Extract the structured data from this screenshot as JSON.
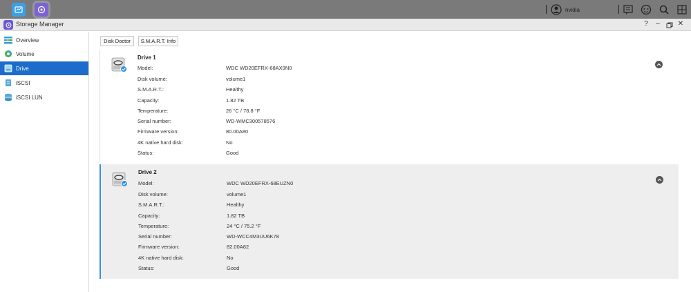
{
  "window": {
    "title": "Storage Manager"
  },
  "taskbar": {
    "username": "nvidia"
  },
  "toolbar": {
    "disk_doctor": "Disk Doctor",
    "smart_info": "S.M.A.R.T. Info"
  },
  "sidebar": {
    "items": [
      {
        "label": "Overview",
        "icon": "overview-icon"
      },
      {
        "label": "Volume",
        "icon": "volume-icon"
      },
      {
        "label": "Drive",
        "icon": "drive-icon",
        "active": true
      },
      {
        "label": "iSCSI",
        "icon": "iscsi-icon"
      },
      {
        "label": "iSCSI LUN",
        "icon": "iscsi-lun-icon"
      }
    ]
  },
  "labels": {
    "model": "Model:",
    "disk_volume": "Disk volume:",
    "smart": "S.M.A.R.T.:",
    "capacity": "Capacity:",
    "temperature": "Temperature:",
    "serial": "Serial number:",
    "firmware": "Firmware version:",
    "native4k": "4K native hard disk:",
    "status": "Status:"
  },
  "drives": [
    {
      "name": "Drive 1",
      "model": "WDC WD20EFRX-68AX9N0",
      "disk_volume": "volume1",
      "smart": "Healthy",
      "capacity": "1.82 TB",
      "temperature": "26 °C / 78.8 °F",
      "serial": "WD-WMC300578576",
      "firmware": "80.00A80",
      "native4k": "No",
      "status": "Good"
    },
    {
      "name": "Drive 2",
      "model": "WDC WD20EFRX-68EUZN0",
      "disk_volume": "volume1",
      "smart": "Healthy",
      "capacity": "1.82 TB",
      "temperature": "24 °C / 75.2 °F",
      "serial": "WD-WCC4M3UU6K78",
      "firmware": "82.00A82",
      "native4k": "No",
      "status": "Good"
    }
  ],
  "colors": {
    "accent": "#1c6ccb",
    "selected_border": "#3a8ee6",
    "taskbar": "#7a7a7a",
    "app_icon": "#6b5bd1"
  }
}
